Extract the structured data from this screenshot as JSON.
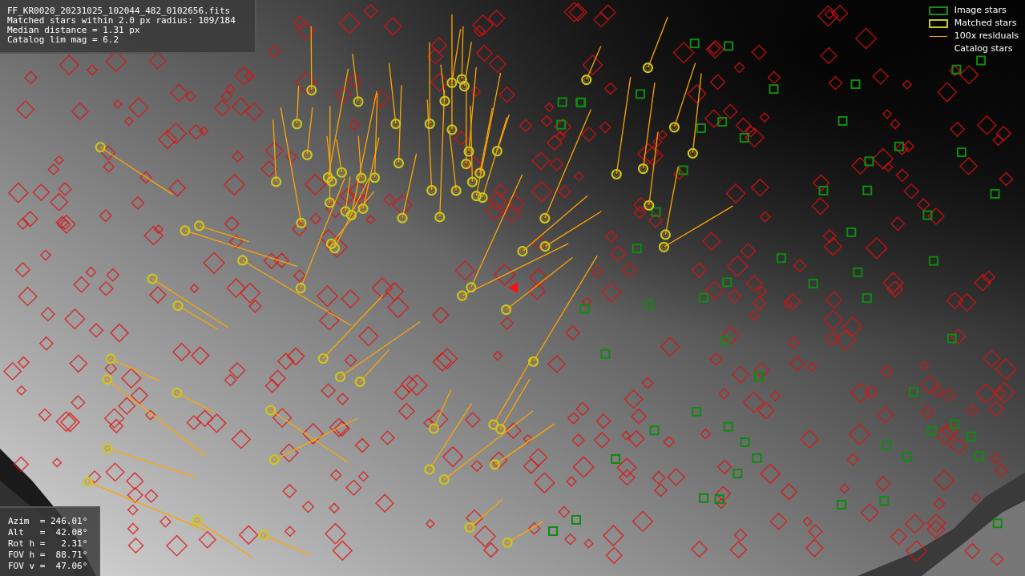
{
  "info_panel": {
    "lines": [
      "FF_KR0020_20231025_102044_482_0102656.fits",
      "Matched stars within 2.0 px radius: 109/184",
      "Median distance = 1.31 px",
      "Catalog lim mag = 6.2"
    ]
  },
  "legend": [
    {
      "label": "Image stars",
      "kind": "box",
      "color": "#1a8a1a"
    },
    {
      "label": "Matched stars",
      "kind": "box",
      "color": "#c8c81e"
    },
    {
      "label": "100x residuals",
      "kind": "line",
      "color": "#ffa500"
    },
    {
      "label": "Catalog stars",
      "kind": "none"
    }
  ],
  "pointing_panel": {
    "lines": [
      "Azim  = 246.01°",
      "Alt   =  42.08°",
      "Rot h =   2.31°",
      "FOV h =  88.71°",
      "FOV v =  47.06°"
    ]
  }
}
